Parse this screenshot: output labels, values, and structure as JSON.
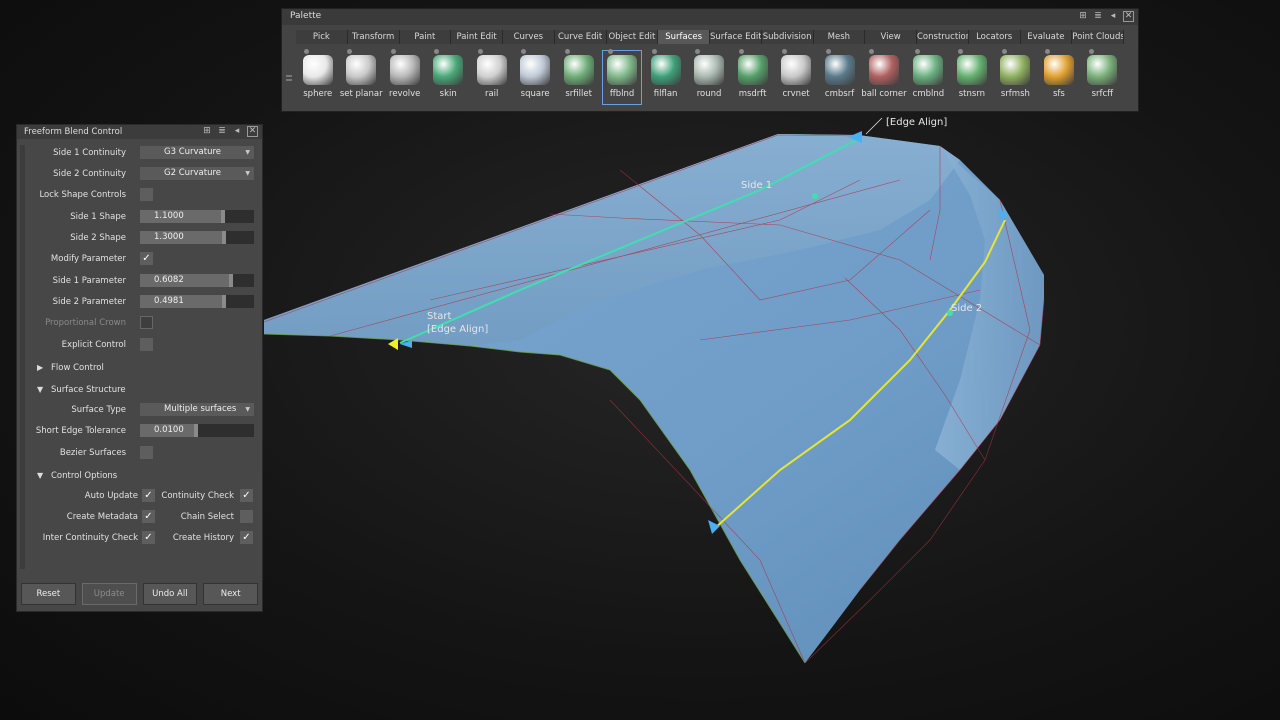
{
  "palette": {
    "title": "Palette",
    "tabs": [
      "Pick",
      "Transform",
      "Paint",
      "Paint Edit",
      "Curves",
      "Curve Edit",
      "Object Edit",
      "Surfaces",
      "Surface Edit",
      "Subdivision",
      "Mesh",
      "View",
      "Construction",
      "Locators",
      "Evaluate",
      "Point Clouds"
    ],
    "active_tab": "Surfaces",
    "tools": [
      {
        "label": "sphere",
        "icon": "sphere-icon",
        "color": "#e8e8e8"
      },
      {
        "label": "set planar",
        "icon": "set-planar-icon",
        "color": "#c9c9c9"
      },
      {
        "label": "revolve",
        "icon": "revolve-icon",
        "color": "#b8b8b8"
      },
      {
        "label": "skin",
        "icon": "skin-icon",
        "color": "#4aa878"
      },
      {
        "label": "rail",
        "icon": "rail-icon",
        "color": "#d0d0d0"
      },
      {
        "label": "square",
        "icon": "square-icon",
        "color": "#bfc9d6"
      },
      {
        "label": "srfillet",
        "icon": "srfillet-icon",
        "color": "#6fae78"
      },
      {
        "label": "ffblnd",
        "icon": "ffblnd-icon",
        "color": "#7fb88a"
      },
      {
        "label": "filflan",
        "icon": "filflan-icon",
        "color": "#3fa07a"
      },
      {
        "label": "round",
        "icon": "round-icon",
        "color": "#aab8b0"
      },
      {
        "label": "msdrft",
        "icon": "msdrft-icon",
        "color": "#56a06a"
      },
      {
        "label": "crvnet",
        "icon": "crvnet-icon",
        "color": "#c8c8c8"
      },
      {
        "label": "cmbsrf",
        "icon": "cmbsrf-icon",
        "color": "#5a7a8a"
      },
      {
        "label": "ball corner",
        "icon": "ball-corner-icon",
        "color": "#b06060"
      },
      {
        "label": "cmblnd",
        "icon": "cmblnd-icon",
        "color": "#6ab080"
      },
      {
        "label": "stnsrn",
        "icon": "stnsrn-icon",
        "color": "#64b070"
      },
      {
        "label": "srfmsh",
        "icon": "srfmsh-icon",
        "color": "#8fb060"
      },
      {
        "label": "sfs",
        "icon": "sfs-icon",
        "color": "#e0a030"
      },
      {
        "label": "srfcff",
        "icon": "srfcff-icon",
        "color": "#7ab07a"
      }
    ]
  },
  "blend": {
    "title": "Freeform Blend Control",
    "side1_continuity_label": "Side 1 Continuity",
    "side1_continuity_value": "G3 Curvature",
    "side2_continuity_label": "Side 2 Continuity",
    "side2_continuity_value": "G2 Curvature",
    "lock_shape_label": "Lock Shape Controls",
    "side1_shape_label": "Side 1 Shape",
    "side1_shape_value": "1.1000",
    "side1_shape_fill": 0.73,
    "side2_shape_label": "Side 2 Shape",
    "side2_shape_value": "1.3000",
    "side2_shape_fill": 0.74,
    "modify_param_label": "Modify Parameter",
    "side1_param_label": "Side 1 Parameter",
    "side1_param_value": "0.6082",
    "side1_param_fill": 0.8,
    "side2_param_label": "Side 2 Parameter",
    "side2_param_value": "0.4981",
    "side2_param_fill": 0.74,
    "prop_crown_label": "Proportional Crown",
    "explicit_label": "Explicit Control",
    "flow_control_label": "Flow Control",
    "surface_structure_label": "Surface Structure",
    "surface_type_label": "Surface Type",
    "surface_type_value": "Multiple surfaces",
    "short_edge_label": "Short Edge Tolerance",
    "short_edge_value": "0.0100",
    "short_edge_fill": 0.49,
    "bezier_label": "Bezier Surfaces",
    "control_options_label": "Control Options",
    "auto_update_label": "Auto Update",
    "continuity_check_label": "Continuity Check",
    "create_metadata_label": "Create Metadata",
    "chain_select_label": "Chain Select",
    "inter_continuity_label": "Inter Continuity Check",
    "create_history_label": "Create History",
    "check": "✓",
    "buttons": {
      "reset": "Reset",
      "update": "Update",
      "undo_all": "Undo All",
      "next": "Next"
    }
  },
  "viewport": {
    "edge_align_top": "[Edge Align]",
    "side1": "Side 1",
    "side2": "Side 2",
    "start": "Start",
    "edge_align_start": "[Edge Align]"
  }
}
